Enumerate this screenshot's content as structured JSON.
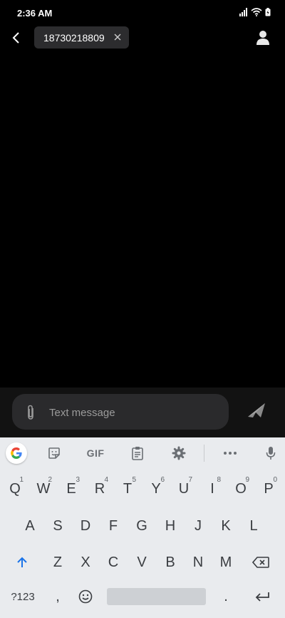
{
  "status_bar": {
    "time": "2:36 AM"
  },
  "recipient": {
    "number": "18730218809"
  },
  "composer": {
    "placeholder": "Text message"
  },
  "keyboard": {
    "toolbar": {
      "gif_label": "GIF"
    },
    "row1": [
      {
        "label": "Q",
        "hint": "1"
      },
      {
        "label": "W",
        "hint": "2"
      },
      {
        "label": "E",
        "hint": "3"
      },
      {
        "label": "R",
        "hint": "4"
      },
      {
        "label": "T",
        "hint": "5"
      },
      {
        "label": "Y",
        "hint": "6"
      },
      {
        "label": "U",
        "hint": "7"
      },
      {
        "label": "I",
        "hint": "8"
      },
      {
        "label": "O",
        "hint": "9"
      },
      {
        "label": "P",
        "hint": "0"
      }
    ],
    "row2": [
      "A",
      "S",
      "D",
      "F",
      "G",
      "H",
      "J",
      "K",
      "L"
    ],
    "row3": [
      "Z",
      "X",
      "C",
      "V",
      "B",
      "N",
      "M"
    ],
    "row4": {
      "symbols_label": "?123",
      "comma": ",",
      "period": "."
    }
  },
  "colors": {
    "background": "#000000",
    "keyboard_bg": "#e9ebee",
    "accent_shift": "#1a73e8",
    "composer_bg": "#2a2a2c"
  },
  "icons": [
    "back-icon",
    "close-icon",
    "contact-icon",
    "attach-icon",
    "send-icon",
    "google-icon",
    "sticker-icon",
    "clipboard-icon",
    "gear-icon",
    "more-icon",
    "mic-icon",
    "shift-icon",
    "backspace-icon",
    "emoji-icon",
    "enter-icon"
  ]
}
